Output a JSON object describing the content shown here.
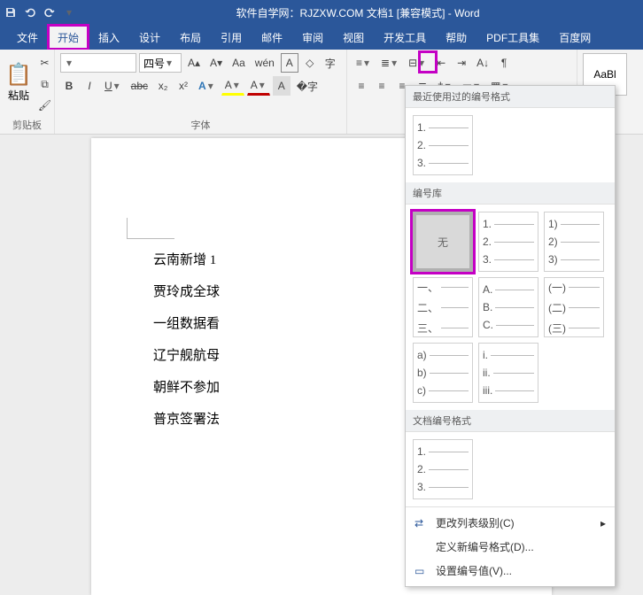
{
  "title": "软件自学网：RJZXW.COM  文档1 [兼容模式] - Word",
  "menu": [
    "文件",
    "开始",
    "插入",
    "设计",
    "布局",
    "引用",
    "邮件",
    "审阅",
    "视图",
    "开发工具",
    "帮助",
    "PDF工具集",
    "百度网"
  ],
  "active_menu": 1,
  "clipboard": {
    "paste": "粘贴",
    "label": "剪贴板"
  },
  "font": {
    "name": "",
    "size": "四号",
    "buttons": {
      "incr": "A",
      "decr": "A",
      "clear": "Aa",
      "phonetic": "wén",
      "charborder": "A",
      "enclose": "字"
    },
    "row2": {
      "bold": "B",
      "italic": "I",
      "underline": "U",
      "strike": "abc",
      "sub": "x₂",
      "sup": "x²",
      "texteffect": "A",
      "highlight": "A",
      "fontcolor": "A",
      "shade": "A",
      "border": "A"
    },
    "label": "字体"
  },
  "para_icons": [
    "list-ul",
    "list-ol",
    "list-multi",
    "indent-dec",
    "indent-inc",
    "sort",
    "show-marks",
    "align-l",
    "align-c",
    "align-r",
    "align-j",
    "line-space",
    "shading",
    "borders"
  ],
  "styles": {
    "item": "AaBl"
  },
  "doc_lines": [
    "云南新增 1",
    "贾玲成全球",
    "一组数据看",
    "辽宁舰航母",
    "朝鲜不参加",
    "普京签署法"
  ],
  "panel": {
    "recent_title": "最近使用过的编号格式",
    "lib_title": "编号库",
    "doc_title": "文档编号格式",
    "none": "无",
    "sets": {
      "num_dot": [
        "1.",
        "2.",
        "3."
      ],
      "num_paren": [
        "1)",
        "2)",
        "3)"
      ],
      "cn_pause": [
        "一、",
        "二、",
        "三、"
      ],
      "abc_dot": [
        "A.",
        "B.",
        "C."
      ],
      "cn_paren": [
        "(一)",
        "(二)",
        "(三)"
      ],
      "low_paren": [
        "a)",
        "b)",
        "c)"
      ],
      "roman": [
        "i.",
        "ii.",
        "iii."
      ]
    },
    "footer": {
      "level": "更改列表级别(C)",
      "define": "定义新编号格式(D)...",
      "setval": "设置编号值(V)..."
    }
  }
}
